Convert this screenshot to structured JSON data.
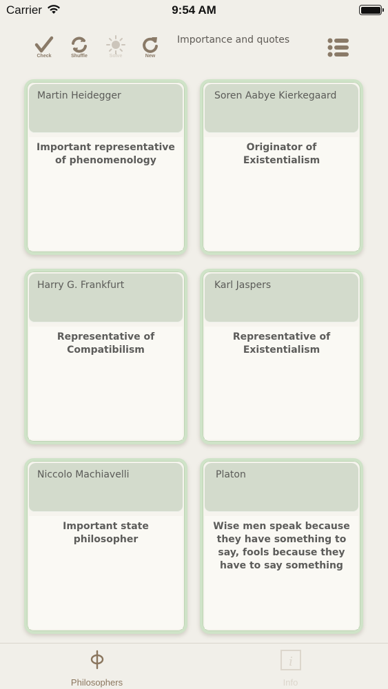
{
  "status_bar": {
    "carrier": "Carrier",
    "time": "9:54 AM"
  },
  "toolbar": {
    "buttons": [
      {
        "label": "Check",
        "icon": "check-icon",
        "enabled": true
      },
      {
        "label": "Shuffle",
        "icon": "shuffle-icon",
        "enabled": true
      },
      {
        "label": "Solve",
        "icon": "sun-icon",
        "enabled": false
      },
      {
        "label": "New",
        "icon": "refresh-icon",
        "enabled": true
      }
    ],
    "title": "Importance and quotes",
    "menu_icon": "list-icon"
  },
  "cards": [
    {
      "name": "Martin Heidegger",
      "text": "Important representative of phenomenology"
    },
    {
      "name": "Soren Aabye Kierkegaard",
      "text": "Originator of Existentialism"
    },
    {
      "name": "Harry G. Frankfurt",
      "text": "Representative of Compatibilism"
    },
    {
      "name": "Karl Jaspers",
      "text": "Representative of Existentialism"
    },
    {
      "name": "Niccolo Machiavelli",
      "text": "Important state philosopher"
    },
    {
      "name": "Platon",
      "text": "Wise men speak because they have something to say, fools because they have to say something"
    }
  ],
  "tab_bar": {
    "tabs": [
      {
        "label": "Philosophers",
        "icon": "phi-icon",
        "active": true
      },
      {
        "label": "Info",
        "icon": "info-icon",
        "active": false
      }
    ]
  },
  "colors": {
    "background": "#f1efe9",
    "card_border": "#cfe3c8",
    "card_header": "#d3dbcc",
    "accent_brown": "#8a765e"
  }
}
